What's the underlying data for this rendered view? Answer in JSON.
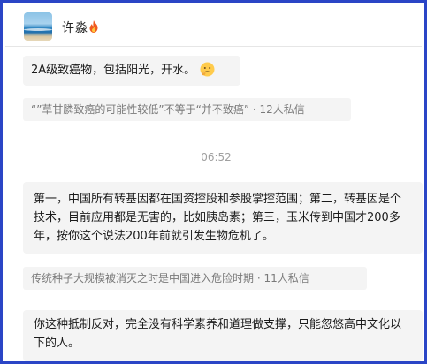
{
  "header": {
    "username": "许淼",
    "username_emoji": "fire-icon"
  },
  "messages": [
    {
      "text": "2A级致癌物，包括阳光，开水。",
      "emoji": "thinking-face-emoji"
    },
    {
      "text": "第一，中国所有转基因都在国资控股和参股掌控范围；第二，转基因是个技术，目前应用都是无害的，比如胰岛素；第三，玉米传到中国才200多年，按你这个说法200年前就引发生物危机了。"
    },
    {
      "text": "你这种抵制反对，完全没有科学素养和道理做支撑，只能忽悠高中文化以下的人。"
    }
  ],
  "tags": [
    {
      "text": "“”草甘膦致癌的可能性较低”不等于“并不致癌” · 12人私信"
    },
    {
      "text": "传统种子大规模被消灭之时是中国进入危险时期 · 11人私信"
    }
  ],
  "timestamp": "06:52",
  "colors": {
    "frame_border": "#2a45c6",
    "bubble_bg": "#f4f4f4",
    "tag_text": "#7a7a7a"
  }
}
